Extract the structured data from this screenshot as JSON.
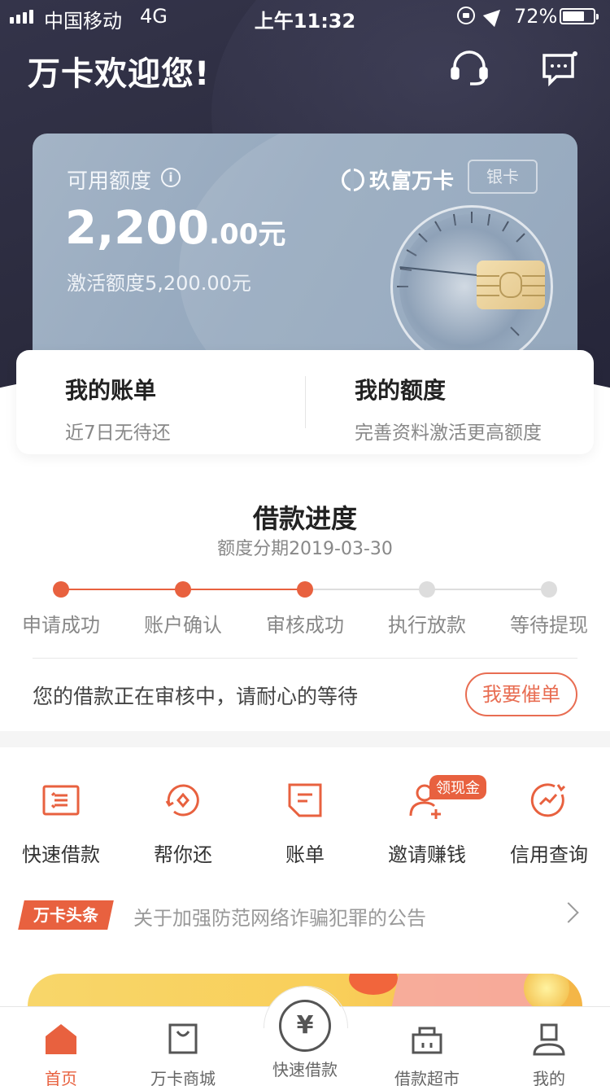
{
  "status_bar": {
    "carrier": "中国移动",
    "network": "4G",
    "time": "上午11:32",
    "battery_percent": "72%",
    "battery_level": 0.72
  },
  "header": {
    "welcome": "万卡欢迎您!",
    "icons": [
      "customer-service-icon",
      "message-icon"
    ]
  },
  "card": {
    "available_label": "可用额度",
    "amount_main": "2,200",
    "amount_decimal": ".00元",
    "activated_text": "激活额度5,200.00元",
    "brand": "玖富万卡",
    "tier": "银卡"
  },
  "summary": {
    "bill_title": "我的账单",
    "bill_sub": "近7日无待还",
    "limit_title": "我的额度",
    "limit_sub": "完善资料激活更高额度"
  },
  "progress": {
    "title": "借款进度",
    "subtitle": "额度分期2019-03-30",
    "steps": [
      {
        "label": "申请成功",
        "done": true
      },
      {
        "label": "账户确认",
        "done": true
      },
      {
        "label": "审核成功",
        "done": true
      },
      {
        "label": "执行放款",
        "done": false
      },
      {
        "label": "等待提现",
        "done": false
      }
    ],
    "message": "您的借款正在审核中，请耐心的等待",
    "urge_button": "我要催单"
  },
  "features": [
    {
      "label": "快速借款",
      "icon": "quick-loan-icon"
    },
    {
      "label": "帮你还",
      "icon": "help-repay-icon"
    },
    {
      "label": "账单",
      "icon": "bill-icon"
    },
    {
      "label": "邀请赚钱",
      "icon": "invite-icon",
      "badge": "领现金"
    },
    {
      "label": "信用查询",
      "icon": "credit-query-icon"
    }
  ],
  "news": {
    "tag": "万卡头条",
    "headline": "关于加强防范网络诈骗犯罪的公告"
  },
  "tabbar": {
    "items": [
      {
        "label": "首页",
        "icon": "home-icon",
        "active": true
      },
      {
        "label": "万卡商城",
        "icon": "shopping-bag-icon",
        "active": false
      },
      {
        "label": "快速借款",
        "icon": "yuan-icon",
        "active": false
      },
      {
        "label": "借款超市",
        "icon": "store-icon",
        "active": false
      },
      {
        "label": "我的",
        "icon": "profile-icon",
        "active": false
      }
    ]
  },
  "colors": {
    "accent": "#e8613f",
    "inactive_step": "#dddddd",
    "header_bg": "#2b2b3e",
    "card_bg": "#93a7bd"
  }
}
